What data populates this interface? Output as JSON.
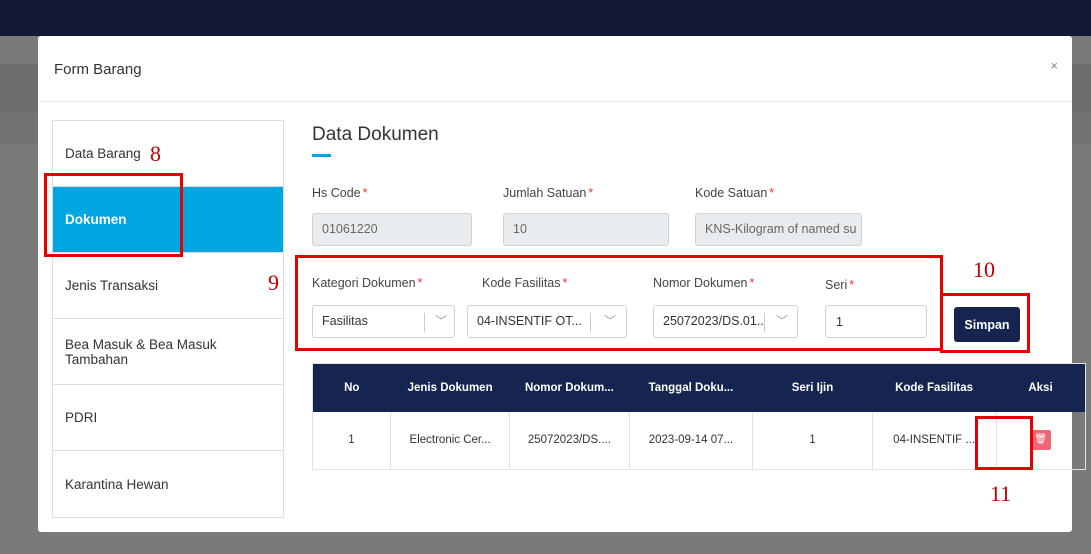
{
  "modal": {
    "title": "Form Barang",
    "close_icon": "×"
  },
  "sidebar": {
    "items": [
      {
        "label": "Data Barang"
      },
      {
        "label": "Dokumen"
      },
      {
        "label": "Jenis Transaksi"
      },
      {
        "label": "Bea Masuk & Bea Masuk Tambahan"
      },
      {
        "label": "PDRI"
      },
      {
        "label": "Karantina Hewan"
      }
    ]
  },
  "section": {
    "title": "Data Dokumen"
  },
  "fields": {
    "hs_code": {
      "label": "Hs Code",
      "value": "01061220"
    },
    "jumlah_satuan": {
      "label": "Jumlah Satuan",
      "value": "10"
    },
    "kode_satuan": {
      "label": "Kode Satuan",
      "value": "KNS-Kilogram of named su"
    },
    "kategori_dokumen": {
      "label": "Kategori Dokumen",
      "value": "Fasilitas"
    },
    "kode_fasilitas": {
      "label": "Kode Fasilitas",
      "value": "04-INSENTIF OT..."
    },
    "nomor_dokumen": {
      "label": "Nomor Dokumen",
      "value": "25072023/DS.01..."
    },
    "seri": {
      "label": "Seri",
      "value": "1"
    },
    "required_mark": "*"
  },
  "buttons": {
    "simpan": "Simpan",
    "delete_icon": "trash-icon"
  },
  "table": {
    "headers": [
      "No",
      "Jenis Dokumen",
      "Nomor Dokum...",
      "Tanggal Doku...",
      "Seri Ijin",
      "Kode Fasilitas",
      "Aksi"
    ],
    "rows": [
      [
        "1",
        "Electronic Cer...",
        "25072023/DS....",
        "2023-09-14 07...",
        "1",
        "04-INSENTIF ..."
      ]
    ]
  },
  "annotations": [
    "8",
    "9",
    "10",
    "11"
  ],
  "colors": {
    "accent": "#00a6e0",
    "navy": "#152550",
    "danger": "#f06473",
    "annotation_red": "#e60000"
  }
}
